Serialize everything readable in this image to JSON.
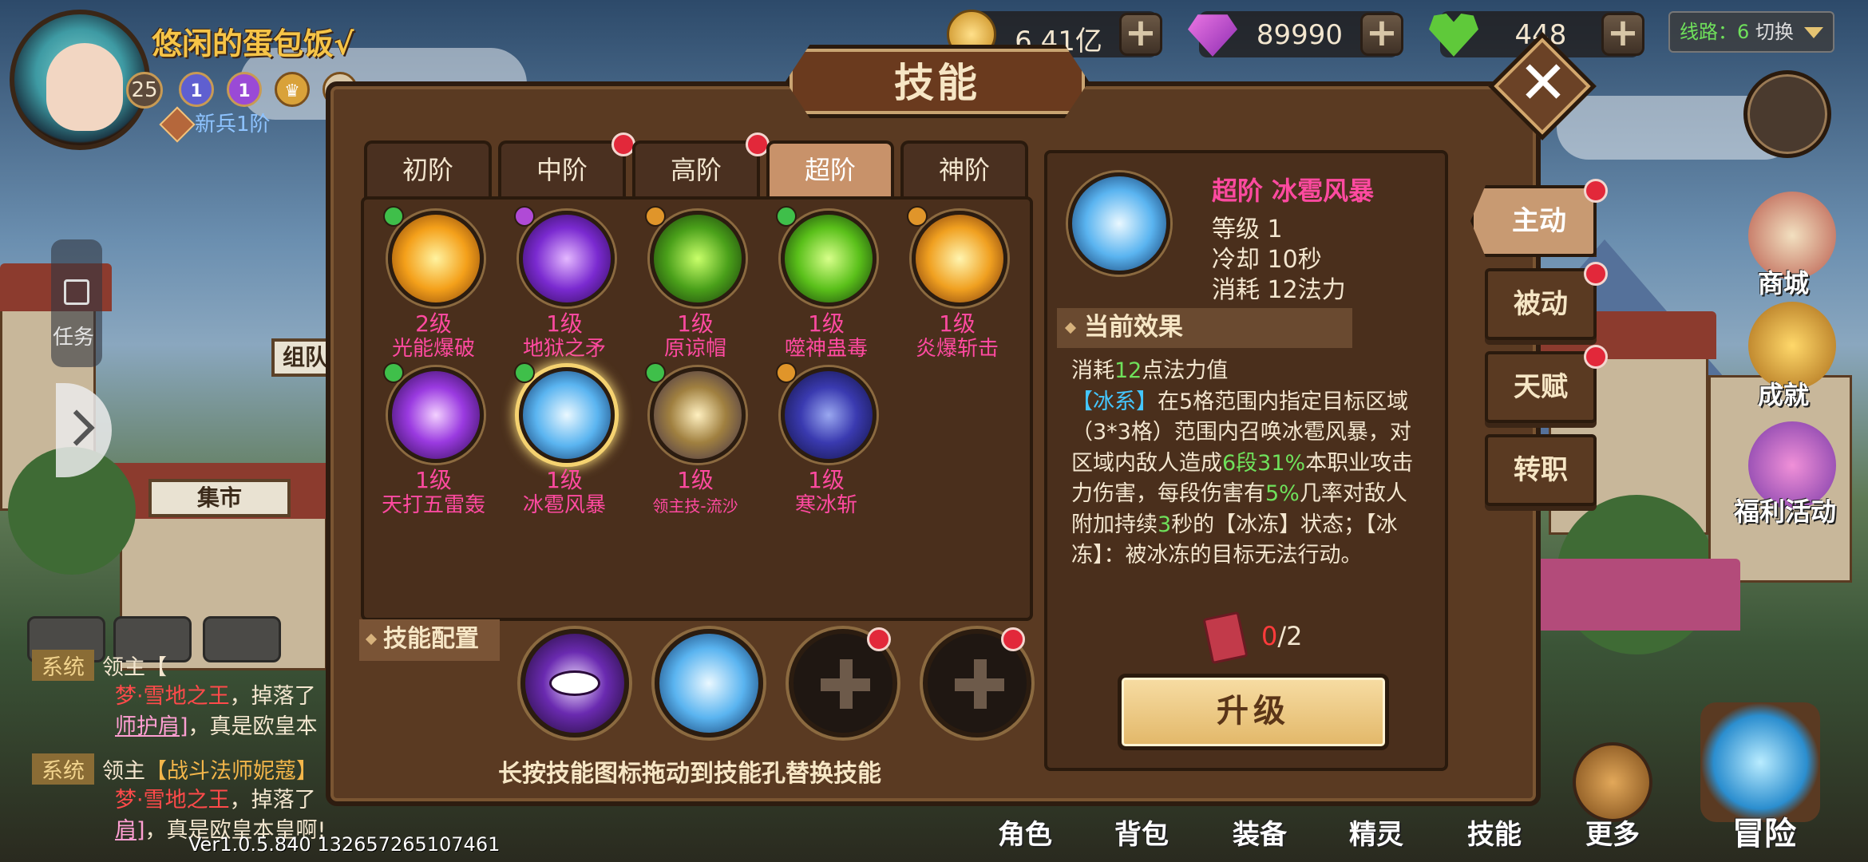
{
  "player": {
    "name": "悠闲的蛋包饭√",
    "level": "25",
    "badge1": "1",
    "badge2": "1",
    "rank": "新兵1阶"
  },
  "currencies": {
    "gold": "6.41亿",
    "gems": "89990",
    "stamina": "448"
  },
  "route": {
    "label": "线路：6",
    "switch": "切换"
  },
  "right_menu": {
    "shop": "商城",
    "achievement": "成就",
    "welfare": "福利活动"
  },
  "left_menu": {
    "task": "任务",
    "team_sign": "组队",
    "market_sign": "集市"
  },
  "bottom_nav": {
    "character": "角色",
    "bag": "背包",
    "equipment": "装备",
    "spirit": "精灵",
    "skill": "技能",
    "more": "更多",
    "adventure": "冒险"
  },
  "chat": {
    "line1_tag": "系统",
    "line1_text": "领主【",
    "line2_red": "梦·雪地之王",
    "line2_text": "，掉落了",
    "line3_pink": "师护肩]",
    "line3_text": "，真是欧皇本",
    "line4_tag": "系统",
    "line4_text": "领主",
    "line4_gold": "【战斗法师妮蔻】",
    "line5_red": "梦·雪地之王",
    "line5_text": "，掉落了",
    "line6_pink": "肩]",
    "line6_text": "，真是欧皇本皇啊!"
  },
  "version": "Ver1.0.5.840 132657265107461",
  "dialog": {
    "title": "技能",
    "tiers": [
      "初阶",
      "中阶",
      "高阶",
      "超阶",
      "神阶"
    ],
    "active_tier": "超阶",
    "skills": [
      {
        "level": "2级",
        "name": "光能爆破",
        "pip": "#3fbf4a"
      },
      {
        "level": "1级",
        "name": "地狱之矛",
        "pip": "#b04ad6"
      },
      {
        "level": "1级",
        "name": "原谅帽",
        "pip": "#e0952a"
      },
      {
        "level": "1级",
        "name": "噬神蛊毒",
        "pip": "#3fbf4a"
      },
      {
        "level": "1级",
        "name": "炎爆斩击",
        "pip": "#e0952a"
      },
      {
        "level": "1级",
        "name": "天打五雷轰",
        "pip": "#3fbf4a"
      },
      {
        "level": "1级",
        "name": "冰雹风暴",
        "pip": "#3fbf4a"
      },
      {
        "level": "1级",
        "name": "领主技-流沙",
        "pip": "#3fbf4a"
      },
      {
        "level": "1级",
        "name": "寒冰斩",
        "pip": "#e0952a"
      }
    ],
    "config_label": "技能配置",
    "hint": "长按技能图标拖动到技能孔替换技能",
    "detail": {
      "title": "超阶  冰雹风暴",
      "level": "等级 1",
      "cooldown": "冷却 10秒",
      "cost": "消耗 12法力",
      "effect_header": "当前效果",
      "effect": {
        "l1a": "消耗",
        "l1g": "12",
        "l1b": "点法力值",
        "l2tag": "【冰系】",
        "l2": "在5格范围内指定目标区域（3*3格）范围内召唤冰雹风暴，对区域内敌人造成",
        "dmg": "6段31%",
        "l3": "本职业攻击力伤害，每段伤害有",
        "chance": "5%",
        "l4": "几率对敌人附加持续",
        "dur": "3",
        "l5": "秒的【冰冻】状态；【冰冻】：被冰冻的目标无法行动。"
      },
      "book_have": "0",
      "book_need": "/2",
      "upgrade": "升级"
    },
    "side_tabs": [
      "主动",
      "被动",
      "天赋",
      "转职"
    ]
  },
  "colors": {
    "accent_pink": "#ff4aa0",
    "effect_green": "#6fe15b",
    "ice_blue": "#44c6ff",
    "dialog_brown": "#5a3a22",
    "notify_red": "#e2283a"
  }
}
